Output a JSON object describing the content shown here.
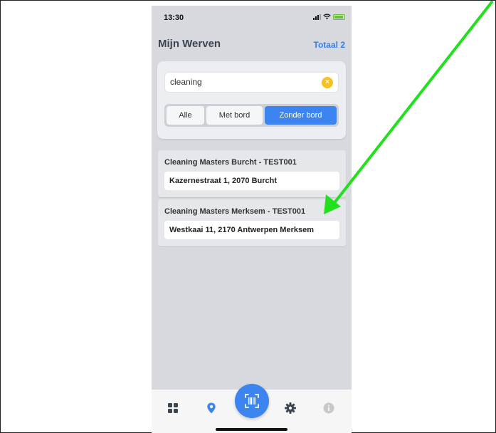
{
  "status_bar": {
    "time": "13:30"
  },
  "header": {
    "title": "Mijn Werven",
    "total": "Totaal 2"
  },
  "search": {
    "value": "cleaning",
    "clear_symbol": "×"
  },
  "filter": {
    "options": [
      "Alle",
      "Met bord",
      "Zonder bord"
    ],
    "selected": "Zonder bord"
  },
  "sites": [
    {
      "name": "Cleaning Masters Burcht - TEST001",
      "address": "Kazernestraat 1, 2070 Burcht"
    },
    {
      "name": "Cleaning Masters Merksem - TEST001",
      "address": "Westkaai 11, 2170 Antwerpen Merksem"
    }
  ],
  "tabbar": {
    "items": [
      "grid-icon",
      "location-pin-icon",
      "barcode-scan-icon",
      "gear-icon",
      "info-icon"
    ],
    "active": "location-pin-icon",
    "accent": "#3c84f0"
  },
  "annotation": {
    "arrow_color": "#22e01e"
  }
}
